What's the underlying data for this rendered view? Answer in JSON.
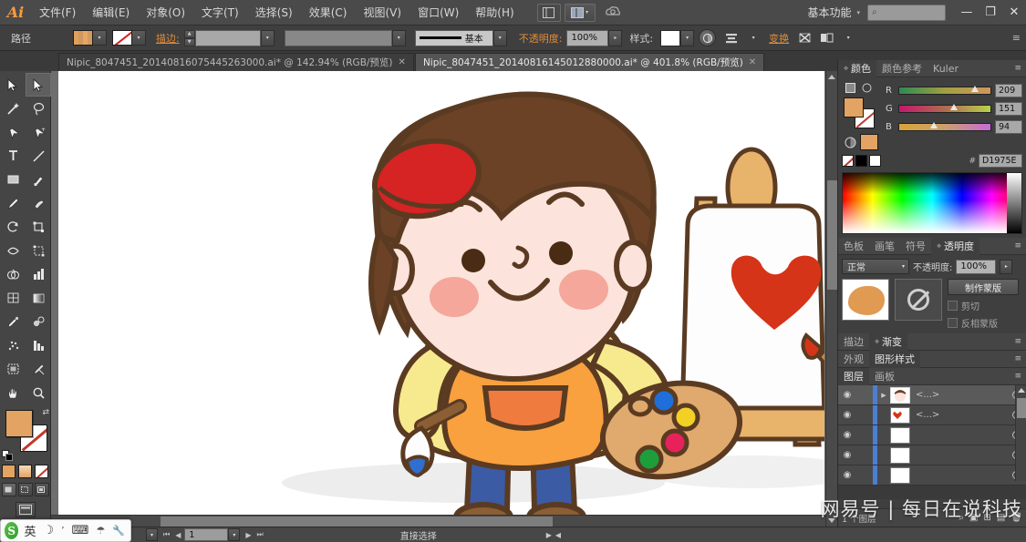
{
  "app": {
    "name": "Adobe Illustrator",
    "logo_text": "Ai"
  },
  "menubar": {
    "items": [
      {
        "label": "文件(F)",
        "name": "menu-file"
      },
      {
        "label": "编辑(E)",
        "name": "menu-edit"
      },
      {
        "label": "对象(O)",
        "name": "menu-object"
      },
      {
        "label": "文字(T)",
        "name": "menu-type"
      },
      {
        "label": "选择(S)",
        "name": "menu-select"
      },
      {
        "label": "效果(C)",
        "name": "menu-effect"
      },
      {
        "label": "视图(V)",
        "name": "menu-view"
      },
      {
        "label": "窗口(W)",
        "name": "menu-window"
      },
      {
        "label": "帮助(H)",
        "name": "menu-help"
      }
    ],
    "bridge_icon": "bridge-icon",
    "arrange_icon": "arrange-documents-icon",
    "workspace": "基本功能",
    "workspace_arrow": "▾",
    "search_icon": "⌕",
    "search_value": "",
    "window_controls": {
      "minimize": "—",
      "restore": "❐",
      "close": "✕"
    }
  },
  "controlbar": {
    "selection_label": "路径",
    "fill_label": "fill-swatch",
    "stroke_label": "stroke-swatch",
    "stroke_link": "描边:",
    "stroke_weight": "",
    "brush_def_label": "基本",
    "opacity_label": "不透明度:",
    "opacity_value": "100%",
    "style_label": "样式:",
    "transform_link": "变换",
    "align_icon": "align-icon",
    "menu_dots": "≡"
  },
  "tabs": [
    {
      "title": "Nipic_8047451_20140816075445263000.ai* @ 142.94% (RGB/预览)",
      "active": false,
      "close": "✕"
    },
    {
      "title": "Nipic_8047451_20140816145012880000.ai* @ 401.8% (RGB/预览)",
      "active": true,
      "close": "✕"
    }
  ],
  "toolbar": {
    "tools": [
      {
        "name": "selection-tool",
        "glyph": "selection"
      },
      {
        "name": "direct-selection-tool",
        "glyph": "direct",
        "selected": true
      },
      {
        "name": "magic-wand-tool",
        "glyph": "wand"
      },
      {
        "name": "lasso-tool",
        "glyph": "lasso"
      },
      {
        "name": "pen-tool",
        "glyph": "pen"
      },
      {
        "name": "add-anchor-point-tool",
        "glyph": "pen2"
      },
      {
        "name": "type-tool",
        "glyph": "type"
      },
      {
        "name": "line-segment-tool",
        "glyph": "line"
      },
      {
        "name": "rectangle-tool",
        "glyph": "rect"
      },
      {
        "name": "paintbrush-tool",
        "glyph": "brush"
      },
      {
        "name": "pencil-tool",
        "glyph": "pencil"
      },
      {
        "name": "blob-brush-tool",
        "glyph": "blob"
      },
      {
        "name": "rotate-tool",
        "glyph": "rotate"
      },
      {
        "name": "scale-tool",
        "glyph": "scale"
      },
      {
        "name": "width-tool",
        "glyph": "width"
      },
      {
        "name": "free-transform-tool",
        "glyph": "freetransform"
      },
      {
        "name": "shape-builder-tool",
        "glyph": "shapebuilder"
      },
      {
        "name": "column-graph-tool",
        "glyph": "graph"
      },
      {
        "name": "mesh-tool",
        "glyph": "mesh"
      },
      {
        "name": "gradient-tool",
        "glyph": "gradient"
      },
      {
        "name": "eyedropper-tool",
        "glyph": "eyedropper"
      },
      {
        "name": "blend-tool",
        "glyph": "blend"
      },
      {
        "name": "symbol-sprayer-tool",
        "glyph": "symbol"
      },
      {
        "name": "bar-graph-tool",
        "glyph": "bargraph"
      },
      {
        "name": "artboard-tool",
        "glyph": "artboard"
      },
      {
        "name": "slice-tool",
        "glyph": "slice"
      },
      {
        "name": "hand-tool",
        "glyph": "hand"
      },
      {
        "name": "zoom-tool",
        "glyph": "zoom"
      }
    ],
    "fill_color": "#E3A362",
    "stroke_color": "#FFFFFF",
    "swap_icon": "⇄",
    "draw_modes": [
      "draw-normal",
      "draw-behind",
      "draw-inside"
    ],
    "screen_mode": "screen-mode-icon"
  },
  "color_panel": {
    "tabs": [
      {
        "label": "颜色",
        "active": true
      },
      {
        "label": "颜色参考",
        "active": false
      },
      {
        "label": "Kuler",
        "active": false
      }
    ],
    "menu": "≡",
    "sliders": [
      {
        "label": "R",
        "value": "209",
        "pos": 82
      },
      {
        "label": "G",
        "value": "151",
        "pos": 59
      },
      {
        "label": "B",
        "value": "94",
        "pos": 37
      }
    ],
    "hex_prefix": "#",
    "hex_value": "D1975E",
    "fill_color": "#D1975E"
  },
  "transparency_panel": {
    "tabs": [
      {
        "label": "色板",
        "active": false
      },
      {
        "label": "画笔",
        "active": false
      },
      {
        "label": "符号",
        "active": false
      },
      {
        "label": "透明度",
        "active": true
      }
    ],
    "menu": "≡",
    "blend_mode": "正常",
    "opacity_label": "不透明度:",
    "opacity_value": "100%",
    "make_mask_label": "制作蒙版",
    "clip_label": "剪切",
    "invert_mask_label": "反相蒙版"
  },
  "stroke_gradient_bar": {
    "tabs": [
      {
        "label": "描边",
        "active": false
      },
      {
        "label": "渐变",
        "active": true
      }
    ],
    "menu": "≡"
  },
  "appearance_bar": {
    "tabs": [
      {
        "label": "外观",
        "active": false
      },
      {
        "label": "图形样式",
        "active": true
      }
    ],
    "menu": "≡"
  },
  "layers_panel": {
    "tabs": [
      {
        "label": "图层",
        "active": true
      },
      {
        "label": "画板",
        "active": false
      }
    ],
    "menu": "≡",
    "rows": [
      {
        "name": "layer-row-1",
        "label": "<...>",
        "eye": "◉",
        "expand": "▶",
        "selected": true
      },
      {
        "name": "layer-row-2",
        "label": "<...>",
        "eye": "◉",
        "expand": "",
        "selected": false
      },
      {
        "name": "layer-row-3",
        "label": "",
        "eye": "◉",
        "expand": "",
        "selected": false
      },
      {
        "name": "layer-row-4",
        "label": "",
        "eye": "◉",
        "expand": "",
        "selected": false
      },
      {
        "name": "layer-row-5",
        "label": "",
        "eye": "◉",
        "expand": "",
        "selected": false
      }
    ],
    "footer_count": "1 个图层",
    "footer_icons": [
      "locate-object-icon",
      "make-clipping-mask-icon",
      "new-sublayer-icon",
      "new-layer-icon",
      "delete-layer-icon"
    ]
  },
  "statusbar": {
    "zoom_value": "401.8%",
    "page_value": "1",
    "status_text": "直接选择",
    "nav_prev": "◀",
    "nav_next": "▶"
  },
  "ime": {
    "logo": "S",
    "items": [
      "英",
      "☽",
      "ʼ",
      "⌨",
      "☂",
      "🔧"
    ]
  },
  "watermark": "网易号 | 每日在说科技",
  "artwork": {
    "description": "cartoon boy painter with red beret, yellow shirt, orange apron, blue jeans, holding palette in front of an easel with a red heart painting",
    "colors": {
      "hair": "#6B4226",
      "beret": "#D62323",
      "skin": "#FCE3DC",
      "cheek": "#F4A79A",
      "shirt": "#F7E98E",
      "apron": "#F9A03F",
      "pocket": "#F07B3F",
      "jeans": "#3B5BA5",
      "shoe": "#8B5E34",
      "palette": "#E0A96D",
      "easel_wood": "#E8B36B",
      "canvas": "#FDFDFD",
      "heart": "#D63418",
      "outline": "#5A3B22"
    },
    "palette_dots": [
      "#1E6FD9",
      "#F2D024",
      "#E8215A",
      "#1E9E3A"
    ]
  }
}
